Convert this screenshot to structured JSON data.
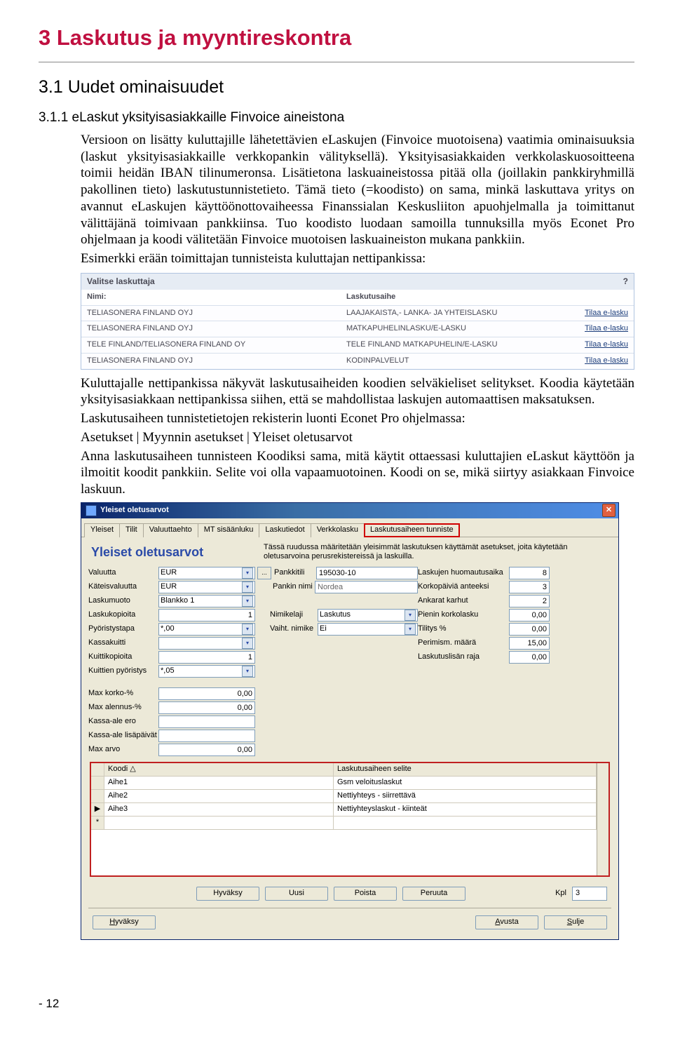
{
  "chapter_title": "3   Laskutus ja myyntireskontra",
  "section_title": "3.1 Uudet ominaisuudet",
  "subsection_title": "3.1.1 eLaskut yksityisasiakkaille Finvoice aineistona",
  "para1": "Versioon on lisätty kuluttajille lähetettävien eLaskujen (Finvoice muotoisena) vaatimia ominaisuuksia (laskut yksityisasiakkaille verkkopankin välityksellä). Yksityisasiakkaiden verkkolaskuosoitteena toimii heidän IBAN tilinumeronsa. Lisätietona laskuaineistossa pitää olla (joillakin pankkiryhmillä pakollinen tieto) laskutustunnistetieto. Tämä tieto (=koodisto) on sama, minkä laskuttava yritys on avannut eLaskujen käyttöönottovaiheessa Finanssialan Keskusliiton apuohjelmalla ja toimittanut välittäjänä toimivaan pankkiinsa. Tuo koodisto luodaan samoilla tunnuksilla myös Econet Pro ohjelmaan ja koodi välitetään Finvoice muotoisen laskuaineiston mukana pankkiin.",
  "para1b": "Esimerkki erään toimittajan tunnisteista kuluttajan nettipankissa:",
  "netbank": {
    "title": "Valitse laskuttaja",
    "help": "?",
    "head_nimi": "Nimi:",
    "head_aihe": "Laskutusaihe",
    "link": "Tilaa e-lasku",
    "rows": [
      {
        "nimi": "TELIASONERA FINLAND OYJ",
        "aihe": "LAAJAKAISTA,- LANKA- JA YHTEISLASKU"
      },
      {
        "nimi": "TELIASONERA FINLAND OYJ",
        "aihe": "MATKAPUHELINLASKU/E-LASKU"
      },
      {
        "nimi": "TELE FINLAND/TELIASONERA FINLAND OY",
        "aihe": "TELE FINLAND MATKAPUHELIN/E-LASKU"
      },
      {
        "nimi": "TELIASONERA FINLAND OYJ",
        "aihe": "KODINPALVELUT"
      }
    ]
  },
  "para2": "Kuluttajalle nettipankissa näkyvät laskutusaiheiden koodien selväkieliset selitykset. Koodia käytetään yksityisasiakkaan nettipankissa siihen, että se mahdollistaa laskujen automaattisen maksatuksen.",
  "para3": "Laskutusaiheen tunnistetietojen rekisterin luonti Econet Pro ohjelmassa:",
  "para4": "Asetukset | Myynnin asetukset | Yleiset oletusarvot",
  "para5": "Anna laskutusaiheen tunnisteen Koodiksi sama, mitä käytit ottaessasi kuluttajien eLaskut käyttöön ja ilmoitit koodit pankkiin. Selite voi olla vapaamuotoinen. Koodi on se, mikä siirtyy asiakkaan Finvoice laskuun.",
  "win": {
    "title": "Yleiset oletusarvot",
    "tabs": [
      "Yleiset",
      "Tilit",
      "Valuuttaehto",
      "MT sisäänluku",
      "Laskutiedot",
      "Verkkolasku",
      "Laskutusaiheen tunniste"
    ],
    "active_tab": 6,
    "heading": "Yleiset oletusarvot",
    "desc": "Tässä ruudussa määritetään yleisimmät laskutuksen käyttämät asetukset, joita käytetään oletusarvoina perusrekistereissä ja laskuilla.",
    "col1": [
      {
        "label": "Valuutta",
        "value": "EUR",
        "type": "select"
      },
      {
        "label": "Käteisvaluutta",
        "value": "EUR",
        "type": "select"
      },
      {
        "label": "Laskumuoto",
        "value": "Blankko 1",
        "type": "select"
      },
      {
        "label": "Laskukopioita",
        "value": "1",
        "type": "num"
      },
      {
        "label": "Pyöristystapa",
        "value": "*,00",
        "type": "select"
      },
      {
        "label": "Kassakuitti",
        "value": "",
        "type": "select"
      },
      {
        "label": "Kuittikopioita",
        "value": "1",
        "type": "num"
      },
      {
        "label": "Kuittien pyöristys",
        "value": "*,05",
        "type": "select"
      },
      {
        "label": "",
        "value": "",
        "type": "spacer"
      },
      {
        "label": "Max korko-%",
        "value": "0,00",
        "type": "num"
      },
      {
        "label": "Max alennus-%",
        "value": "0,00",
        "type": "num"
      },
      {
        "label": "Kassa-ale ero",
        "value": "",
        "type": "num"
      },
      {
        "label": "Kassa-ale lisäpäivät",
        "value": "",
        "type": "num"
      },
      {
        "label": "Max arvo",
        "value": "0,00",
        "type": "num"
      }
    ],
    "col2": [
      {
        "label": "Pankkitili",
        "value": "195030-10",
        "type": "input",
        "btn": "..."
      },
      {
        "label": "Pankin nimi",
        "value": "Nordea",
        "type": "ro"
      },
      {
        "label": "",
        "value": "",
        "type": "spacer"
      },
      {
        "label": "Nimikelaji",
        "value": "Laskutus",
        "type": "select"
      },
      {
        "label": "Vaiht. nimike",
        "value": "Ei",
        "type": "select"
      }
    ],
    "col3": [
      {
        "label": "Laskujen huomautusaika",
        "value": "8",
        "type": "num"
      },
      {
        "label": "Korkopäiviä anteeksi",
        "value": "3",
        "type": "num"
      },
      {
        "label": "Ankarat karhut",
        "value": "2",
        "type": "num"
      },
      {
        "label": "Pienin korkolasku",
        "value": "0,00",
        "type": "num"
      },
      {
        "label": "Tilitys %",
        "value": "0,00",
        "type": "num"
      },
      {
        "label": "Perimism. määrä",
        "value": "15,00",
        "type": "num"
      },
      {
        "label": "Laskutuslisän raja",
        "value": "0,00",
        "type": "num"
      }
    ],
    "grid": {
      "head": {
        "col1": "Koodi  △",
        "col2": "Laskutusaiheen selite"
      },
      "rows": [
        {
          "mark": "",
          "col1": "Aihe1",
          "col2": "Gsm veloituslaskut"
        },
        {
          "mark": "",
          "col1": "Aihe2",
          "col2": "Nettiyhteys - siirrettävä"
        },
        {
          "mark": "▶",
          "col1": "Aihe3",
          "col2": "Nettiyhteyslaskut - kiinteät"
        },
        {
          "mark": "*",
          "col1": "",
          "col2": ""
        }
      ]
    },
    "inner_buttons": [
      "Hyväksy",
      "Uusi",
      "Poista",
      "Peruuta"
    ],
    "kpl_label": "Kpl",
    "kpl_value": "3",
    "footer_buttons": {
      "left": "Hyväksy",
      "right1": "Avusta",
      "right2": "Sulje"
    }
  },
  "page_number": "- 12"
}
